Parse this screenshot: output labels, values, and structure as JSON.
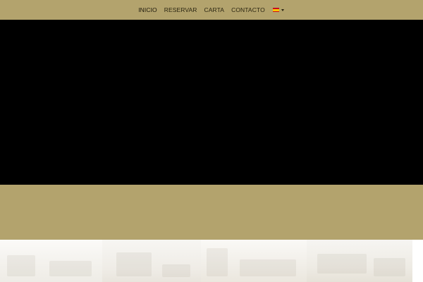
{
  "nav": {
    "items": [
      {
        "label": "INICIO",
        "active": true
      },
      {
        "label": "RESERVAR",
        "active": false
      },
      {
        "label": "CARTA",
        "active": false
      },
      {
        "label": "CONTACTO",
        "active": false
      }
    ],
    "language": {
      "icon": "spain-flag-icon",
      "dropdown_icon": "caret-down-icon"
    }
  },
  "colors": {
    "accent": "#b3a36d",
    "hero_background": "#000000",
    "nav_text": "#2a2410"
  },
  "gallery": {
    "tiles": [
      "restaurant-photo",
      "restaurant-photo",
      "restaurant-photo",
      "restaurant-photo"
    ]
  }
}
